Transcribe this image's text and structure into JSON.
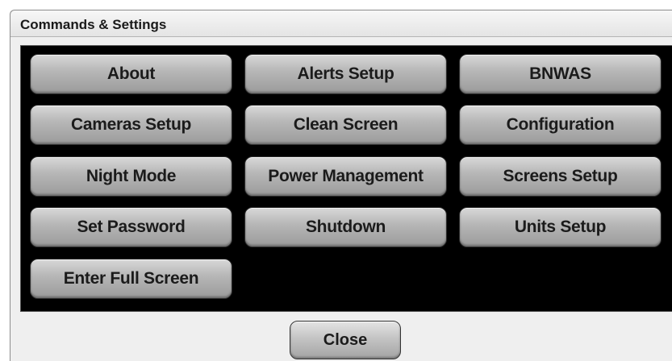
{
  "dialog": {
    "title": "Commands & Settings"
  },
  "commands": [
    {
      "label": "About"
    },
    {
      "label": "Alerts Setup"
    },
    {
      "label": "BNWAS"
    },
    {
      "label": "Cameras Setup"
    },
    {
      "label": "Clean Screen"
    },
    {
      "label": "Configuration"
    },
    {
      "label": "Night Mode"
    },
    {
      "label": "Power Management"
    },
    {
      "label": "Screens Setup"
    },
    {
      "label": "Set Password"
    },
    {
      "label": "Shutdown"
    },
    {
      "label": "Units Setup"
    },
    {
      "label": "Enter Full Screen"
    }
  ],
  "footer": {
    "close_label": "Close"
  }
}
